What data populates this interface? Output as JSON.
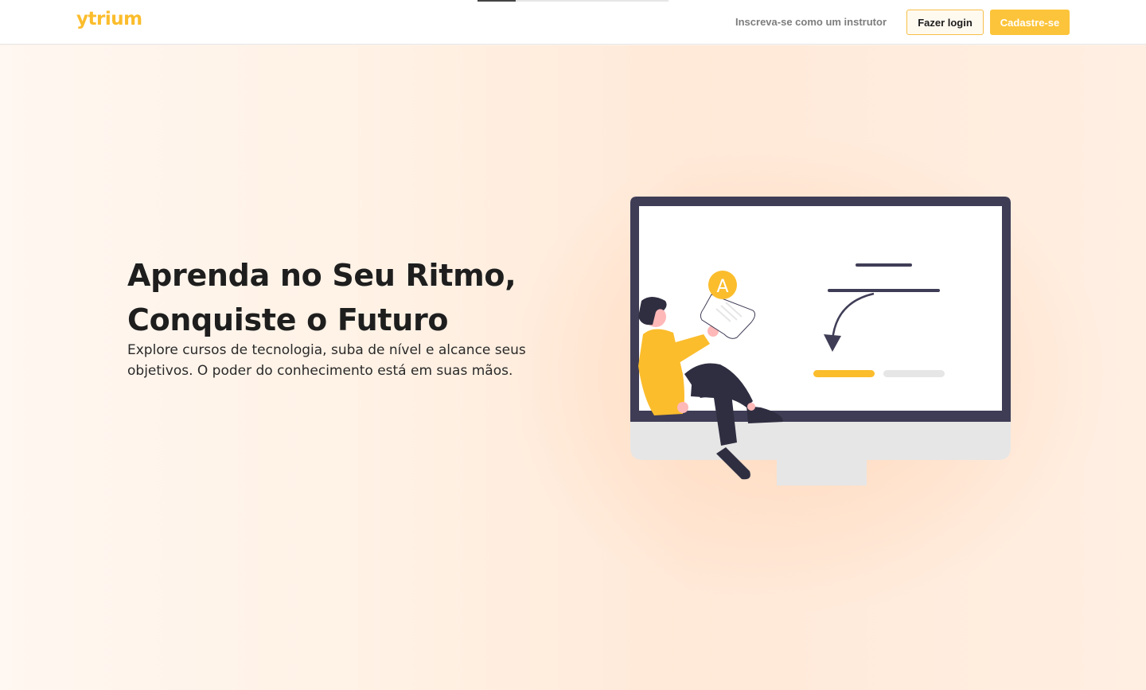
{
  "header": {
    "logo": "ytrium",
    "progress": 0.2,
    "instructor_link": "Inscreva-se como um instrutor",
    "login_button": "Fazer login",
    "signup_button": "Cadastre-se"
  },
  "hero": {
    "title_line1": "Aprenda no Seu Ritmo,",
    "title_line2": "Conquiste o Futuro",
    "subtitle": "Explore cursos de tecnologia, suba de nível e alcance seus objetivos. O poder do conhecimento está em suas mãos.",
    "illustration": {
      "badge_letter": "A",
      "icons": [
        "monitor-icon",
        "person-figure",
        "paper-note-icon",
        "arrow-icon"
      ]
    }
  },
  "colors": {
    "accent": "#fcc43a",
    "logo": "#fbbd2c",
    "monitor_frame": "#3f3d56",
    "text_dark": "#1e1e1e",
    "background": "#fef3ea"
  }
}
